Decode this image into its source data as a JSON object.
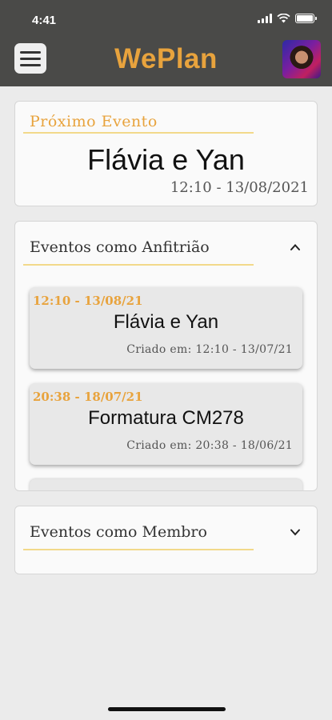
{
  "status_bar": {
    "time": "4:41"
  },
  "header": {
    "app_title": "WePlan",
    "menu_icon": "hamburger-menu-icon",
    "avatar": "user-avatar",
    "background_color": "#4a4a48",
    "title_color": "#e8a33d"
  },
  "next_event": {
    "label": "Próximo Evento",
    "title": "Flávia e Yan",
    "datetime": "12:10 - 13/08/2021"
  },
  "host_events": {
    "label": "Eventos como Anfitrião",
    "chevron_icon": "chevron-up-icon",
    "expanded": true,
    "items": [
      {
        "datetime": "12:10 - 13/08/21",
        "title": "Flávia e Yan",
        "created": "Criado em: 12:10 -  13/07/21"
      },
      {
        "datetime": "20:38 - 18/07/21",
        "title": "Formatura CM278",
        "created": "Criado em: 20:38 -  18/06/21"
      }
    ]
  },
  "member_events": {
    "label": "Eventos como Membro",
    "chevron_icon": "chevron-down-icon",
    "expanded": false
  }
}
